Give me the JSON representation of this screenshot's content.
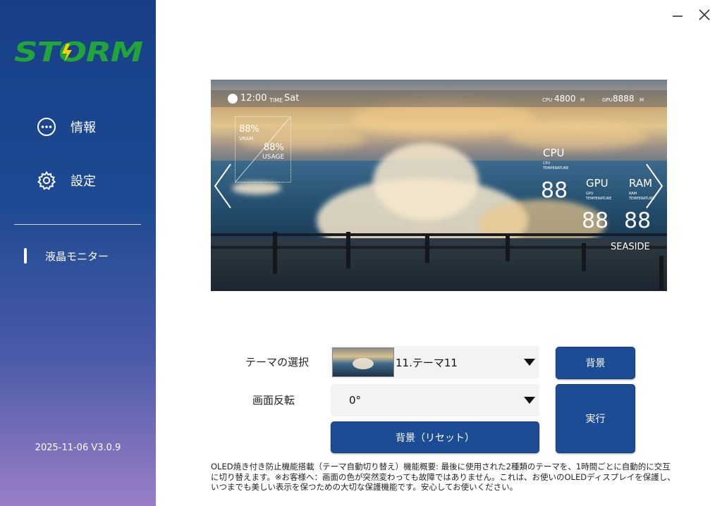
{
  "app": {
    "logo_text": "STORM",
    "version": "2025-11-06 V3.0.9"
  },
  "sidebar": {
    "items": [
      {
        "label": "情報",
        "icon": "more-circle-icon"
      },
      {
        "label": "設定",
        "icon": "gear-icon"
      }
    ],
    "active_item": {
      "label": "液晶モニター"
    }
  },
  "preview": {
    "time": "12:00",
    "time_label": "TIME",
    "day": "Sat",
    "cpu_label": "CPU",
    "cpu_clock": "4800",
    "cpu_unit": "M",
    "gpu_label": "GPU",
    "gpu_clock": "8888",
    "gpu_unit": "M",
    "vram_value": "88%",
    "vram_label": "VRAM",
    "usage_value": "88%",
    "usage_label": "USAGE",
    "cpu_temp_title": "CPU",
    "cpu_temp_sub": "CPU",
    "cpu_temp_caption": "TEMPERATURE",
    "cpu_temp_value": "88",
    "gpu_temp_title": "GPU",
    "gpu_temp_sub": "GPU",
    "gpu_temp_caption": "TEMPERATURE",
    "gpu_temp_value": "88",
    "ram_title": "RAM",
    "ram_sub": "RAM",
    "ram_caption": "TEMPERATURE",
    "ram_value": "88",
    "theme_name": "SEASIDE"
  },
  "controls": {
    "theme_label": "テーマの選択",
    "theme_value": "11.テーマ11",
    "rotation_label": "画面反転",
    "rotation_value": "0°",
    "background_button": "背景",
    "reset_button": "背景（リセット）",
    "run_button": "実行"
  },
  "note": "OLED焼き付き防止機能搭載（テーマ自動切り替え）機能概要: 最後に使用された2種類のテーマを、1時間ごとに自動的に交互に切り替えます。※お客様へ：画面の色が突然変わっても故障ではありません。これは、お使いのOLEDディスプレイを保護し、いつまでも美しい表示を保つための大切な保護機能です。安心してお使いください。",
  "colors": {
    "sidebar_top": "#173f88",
    "sidebar_bottom": "#9a7ec8",
    "logo_green": "#22a538",
    "logo_bolt": "#f5d400",
    "button_blue": "#1c4c94"
  }
}
